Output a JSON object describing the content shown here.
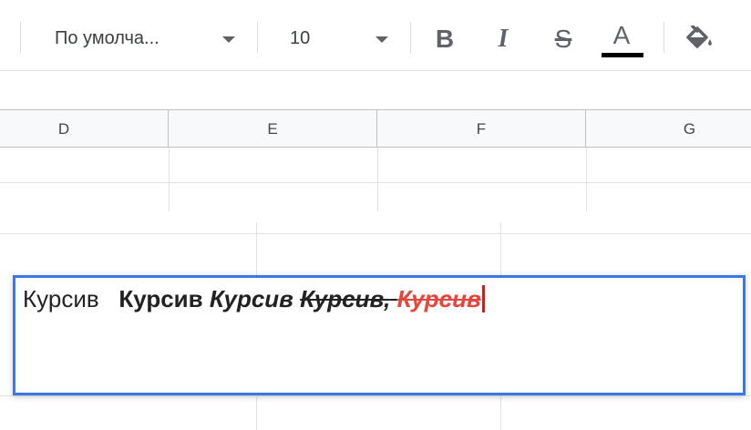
{
  "toolbar": {
    "font_family": "По умолча...",
    "font_size": "10",
    "bold_glyph": "B",
    "italic_glyph": "I",
    "strike_glyph": "S",
    "text_color_glyph": "A",
    "text_color": "#000000"
  },
  "columns": [
    "D",
    "E",
    "F",
    "G"
  ],
  "edit_cell": {
    "seg_plain": "Курсив",
    "seg_bold": "Курсив",
    "seg_bold_italic": "Курсив",
    "seg_strike": "Курсив,",
    "seg_red": "Курсив",
    "red_color": "#e8453c"
  },
  "colors": {
    "selection_border": "#3b78e7",
    "gridline": "#e2e3e3",
    "header_bg": "#f8f9fa"
  }
}
